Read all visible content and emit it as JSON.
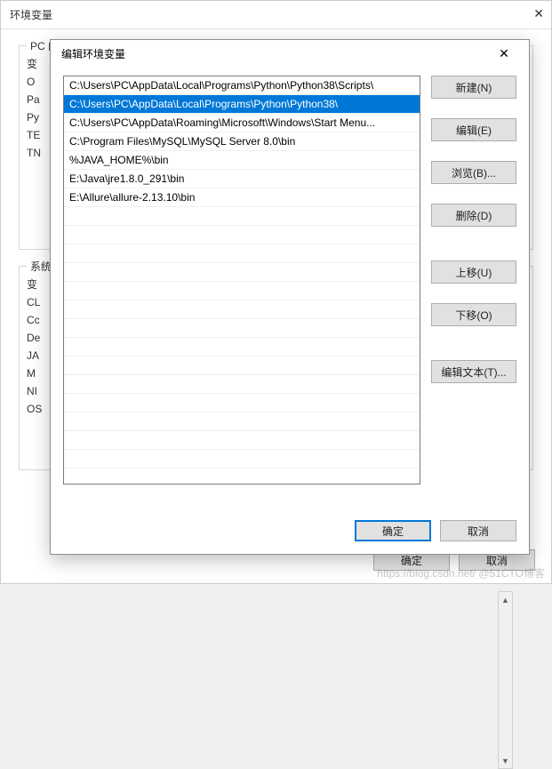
{
  "parent": {
    "title": "环境变量",
    "group_user_label": "PC 的",
    "group_sys_label": "系统",
    "user_hints": [
      "变",
      "O",
      "Pa",
      "Py",
      "TE",
      "TN"
    ],
    "sys_hints": [
      "变",
      "CL",
      "Cc",
      "De",
      "JA",
      "M",
      "NI",
      "OS"
    ],
    "ok": "确定",
    "cancel": "取消"
  },
  "modal": {
    "title": "编辑环境变量",
    "close_label": "✕",
    "selected_index": 1,
    "paths": [
      "C:\\Users\\PC\\AppData\\Local\\Programs\\Python\\Python38\\Scripts\\",
      "C:\\Users\\PC\\AppData\\Local\\Programs\\Python\\Python38\\",
      "C:\\Users\\PC\\AppData\\Roaming\\Microsoft\\Windows\\Start Menu...",
      "C:\\Program Files\\MySQL\\MySQL Server 8.0\\bin",
      "%JAVA_HOME%\\bin",
      "E:\\Java\\jre1.8.0_291\\bin",
      "E:\\Allure\\allure-2.13.10\\bin"
    ],
    "buttons": {
      "new": "新建(N)",
      "edit": "编辑(E)",
      "browse": "浏览(B)...",
      "delete": "删除(D)",
      "move_up": "上移(U)",
      "move_down": "下移(O)",
      "edit_text": "编辑文本(T)..."
    },
    "ok": "确定",
    "cancel": "取消"
  },
  "watermark": "https://blog.csdn.net/       @51CTO博客"
}
